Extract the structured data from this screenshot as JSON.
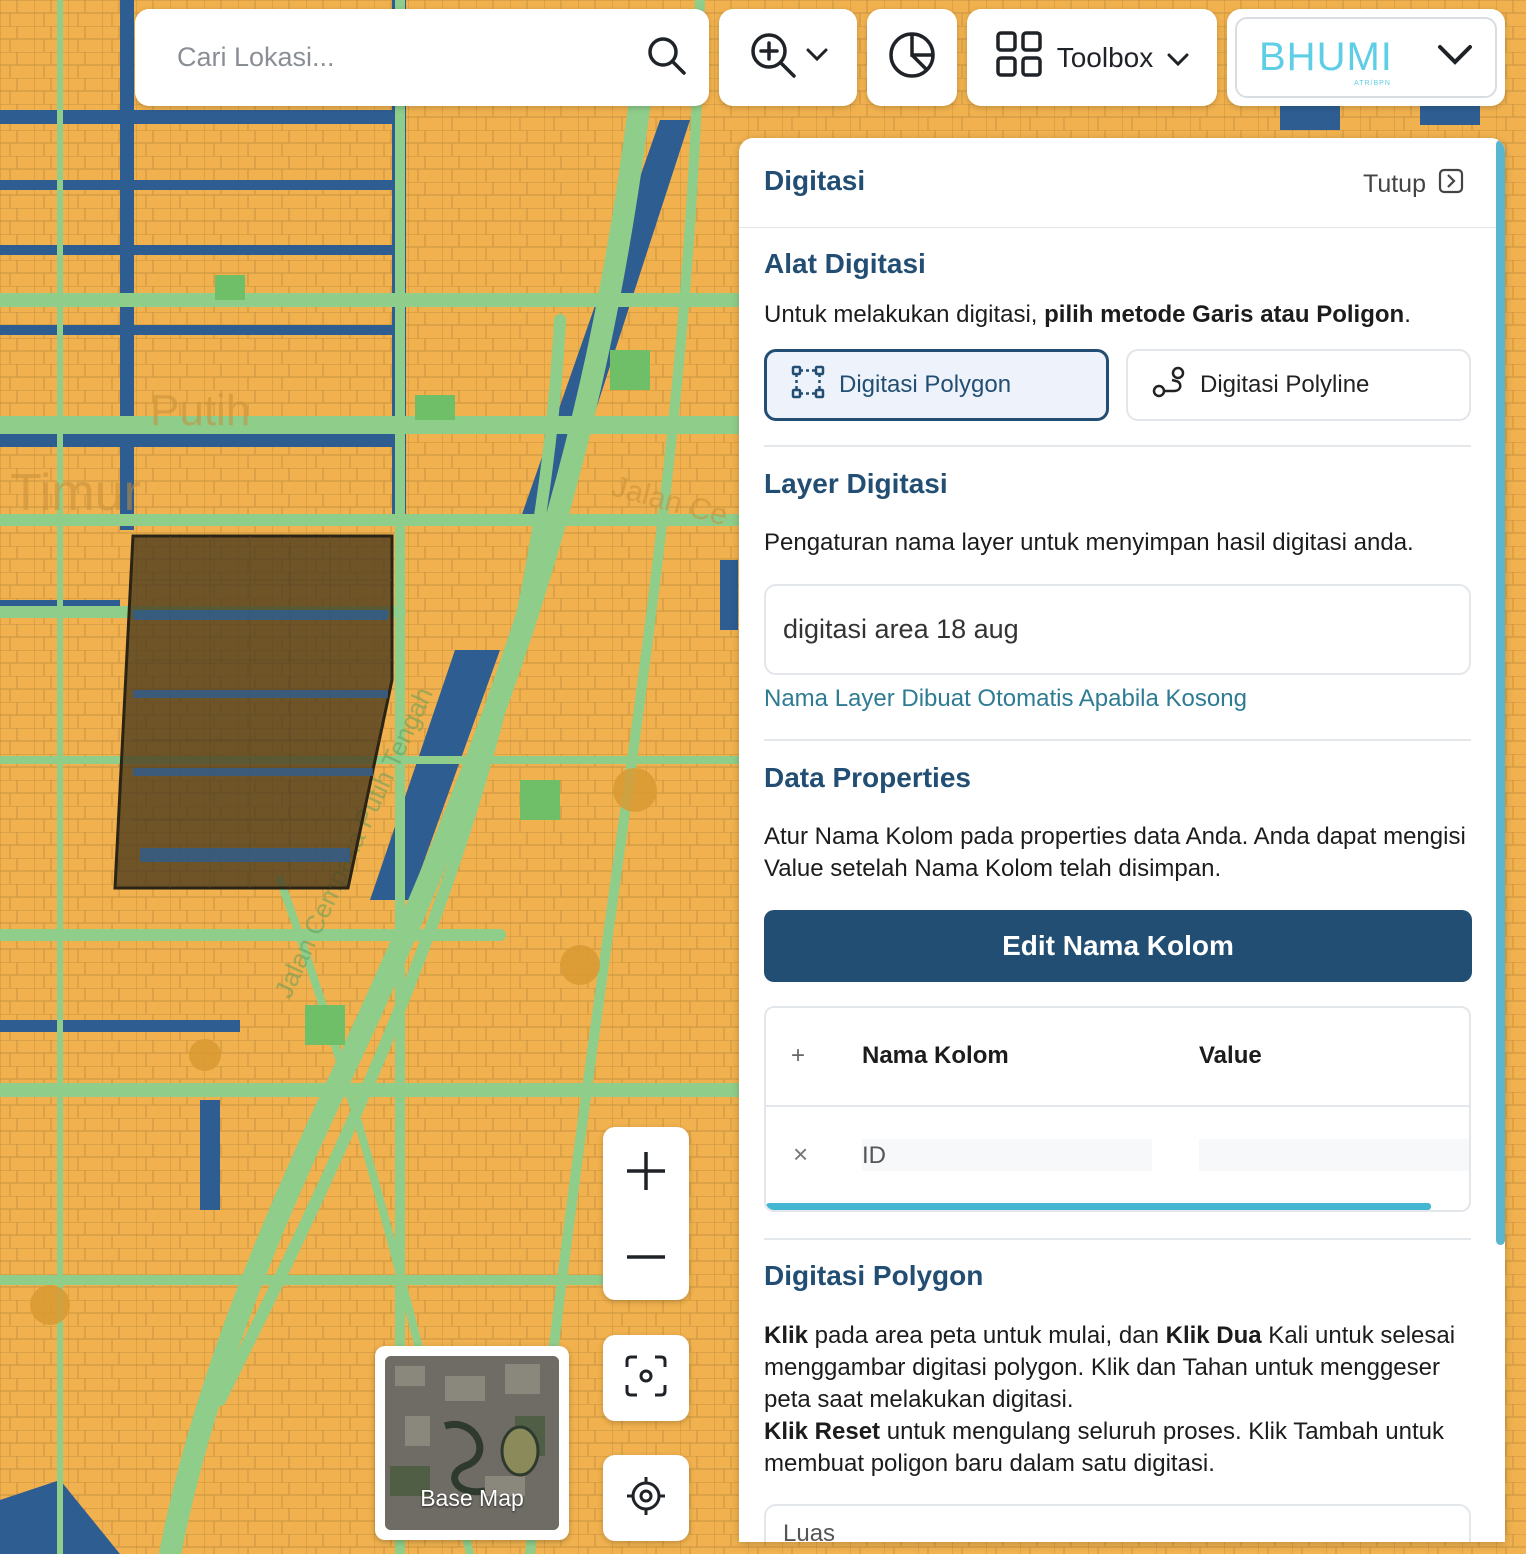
{
  "search": {
    "placeholder": "Cari Lokasi..."
  },
  "toolbar": {
    "toolbox_label": "Toolbox"
  },
  "brand": {
    "name": "BHUMI",
    "sub": "ATR/BPN"
  },
  "map": {
    "street_labels": [
      "Jalan Cempaka Putih Tengah",
      "Jalan Ce",
      "Timur",
      "Putih"
    ]
  },
  "panel": {
    "title": "Digitasi",
    "close_label": "Tutup",
    "tools": {
      "title": "Alat Digitasi",
      "desc_prefix": "Untuk melakukan digitasi, ",
      "desc_bold": "pilih metode Garis atau Poligon",
      "desc_suffix": ".",
      "polygon_label": "Digitasi Polygon",
      "polyline_label": "Digitasi Polyline"
    },
    "layer": {
      "title": "Layer Digitasi",
      "desc": "Pengaturan nama layer untuk menyimpan hasil digitasi anda.",
      "value": "digitasi area 18 aug",
      "hint": "Nama Layer Dibuat Otomatis Apabila Kosong"
    },
    "props": {
      "title": "Data Properties",
      "desc": "Atur Nama Kolom pada properties data Anda. Anda dapat mengisi Value setelah Nama Kolom telah disimpan.",
      "edit_label": "Edit Nama Kolom",
      "add_symbol": "+",
      "col_name": "Nama Kolom",
      "col_value": "Value",
      "rows": [
        {
          "remove_symbol": "×",
          "name": "ID",
          "value": ""
        }
      ]
    },
    "polygon_help": {
      "title": "Digitasi Polygon",
      "p1_b1": "Klik",
      "p1_t1": " pada area peta untuk mulai, dan ",
      "p1_b2": "Klik Dua",
      "p1_t2": " Kali untuk selesai menggambar digitasi polygon. Klik dan Tahan untuk menggeser peta saat melakukan digitasi.",
      "p2_b1": "Klik Reset",
      "p2_t1": " untuk mengulang seluruh proses. Klik Tambah untuk membuat poligon baru dalam satu digitasi."
    },
    "luas_label": "Luas"
  },
  "basemap": {
    "label": "Base Map"
  },
  "colors": {
    "accent": "#234e73",
    "teal": "#2e7c94",
    "map_parcel": "#f0b14e",
    "map_road": "#8fcd8a",
    "map_water": "#2e5d91"
  }
}
